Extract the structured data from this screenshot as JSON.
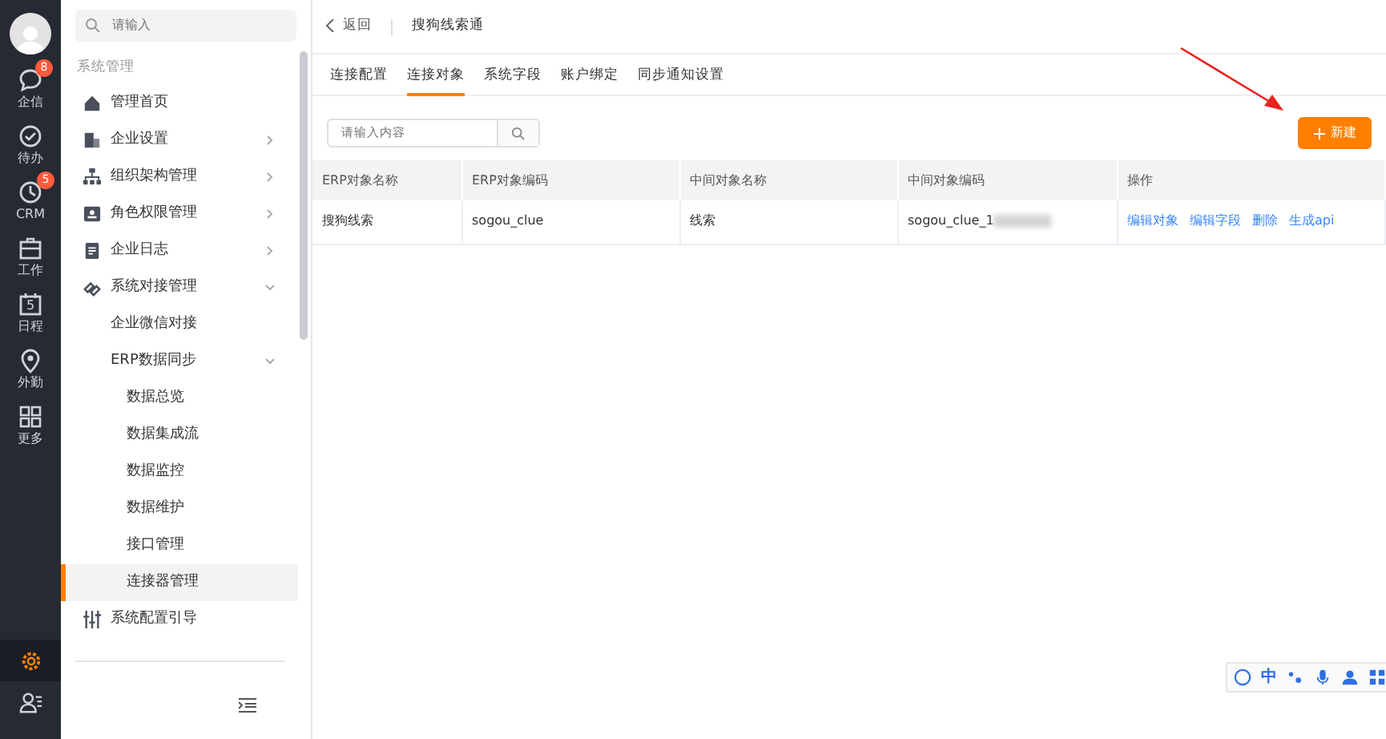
{
  "rail": {
    "items": [
      {
        "label": "企信",
        "badge": "8"
      },
      {
        "label": "待办"
      },
      {
        "label": "CRM",
        "badge": "5"
      },
      {
        "label": "工作"
      },
      {
        "label": "日程",
        "day": "5"
      },
      {
        "label": "外勤"
      },
      {
        "label": "更多"
      }
    ],
    "bottom": [
      {
        "selected": true
      },
      {
        "selected": false
      }
    ]
  },
  "sidebar": {
    "search": {
      "placeholder": "请输入"
    },
    "section": "系统管理",
    "items": [
      {
        "label": "管理首页",
        "selected": false
      },
      {
        "label": "企业设置",
        "expanded": false,
        "selected": false
      },
      {
        "label": "组织架构管理",
        "expanded": false,
        "selected": false
      },
      {
        "label": "角色权限管理",
        "expanded": false,
        "selected": false
      },
      {
        "label": "企业日志",
        "expanded": false,
        "selected": false
      },
      {
        "label": "系统对接管理",
        "expanded": true,
        "selected": false,
        "children": [
          {
            "label": "企业微信对接",
            "selected": false
          },
          {
            "label": "ERP数据同步",
            "expanded": true,
            "selected": false,
            "children": [
              {
                "label": "数据总览",
                "selected": false
              },
              {
                "label": "数据集成流",
                "selected": false
              },
              {
                "label": "数据监控",
                "selected": false
              },
              {
                "label": "数据维护",
                "selected": false
              },
              {
                "label": "接口管理",
                "selected": false
              },
              {
                "label": "连接器管理",
                "selected": true
              }
            ]
          }
        ]
      },
      {
        "label": "系统配置引导",
        "selected": false
      }
    ]
  },
  "header": {
    "back": "返回",
    "title": "搜狗线索通"
  },
  "tabs": [
    {
      "label": "连接配置",
      "selected": false
    },
    {
      "label": "连接对象",
      "selected": true
    },
    {
      "label": "系统字段",
      "selected": false
    },
    {
      "label": "账户绑定",
      "selected": false
    },
    {
      "label": "同步通知设置",
      "selected": false
    }
  ],
  "toolbar": {
    "search": {
      "placeholder": "请输入内容"
    },
    "new_button": "新建"
  },
  "table": {
    "columns": [
      "ERP对象名称",
      "ERP对象编码",
      "中间对象名称",
      "中间对象编码",
      "操作"
    ],
    "rows": [
      {
        "cells": [
          "搜狗线索",
          "sogou_clue",
          "线索",
          "sogou_clue_1"
        ],
        "blurred": true,
        "actions": [
          "编辑对象",
          "编辑字段",
          "删除",
          "生成api"
        ]
      }
    ]
  },
  "annotation": {
    "kind": "arrow",
    "color": "#e8231f"
  },
  "ime_toolbar": {
    "label": "中"
  }
}
